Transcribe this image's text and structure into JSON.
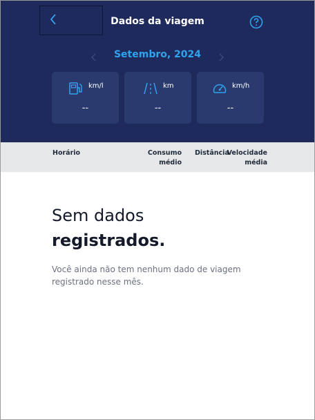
{
  "header": {
    "title": "Dados da viagem",
    "back_icon": "chevron-left-icon",
    "help_icon": "help-circle-icon"
  },
  "month_selector": {
    "label": "Setembro, 2024",
    "prev_icon": "chevron-left-icon",
    "next_icon": "chevron-right-icon"
  },
  "stats": [
    {
      "icon": "fuel-pump-icon",
      "unit": "km/l",
      "value": "--"
    },
    {
      "icon": "road-icon",
      "unit": "km",
      "value": "--"
    },
    {
      "icon": "speedometer-icon",
      "unit": "km/h",
      "value": "--"
    }
  ],
  "table_header": {
    "time": "Horário",
    "consumption_line1": "Consumo",
    "consumption_line2": "médio",
    "distance": "Distância",
    "speed_line1": "Velocidade",
    "speed_line2": "média"
  },
  "empty_state": {
    "title_line1": "Sem dados",
    "title_line2": "registrados.",
    "description": "Você ainda não tem nenhum dado de viagem registrado nesse mês."
  },
  "colors": {
    "header_bg": "#1f2a5c",
    "card_bg": "#2a3a6e",
    "accent": "#2fa3ee",
    "table_header_bg": "#e6e7e8"
  }
}
